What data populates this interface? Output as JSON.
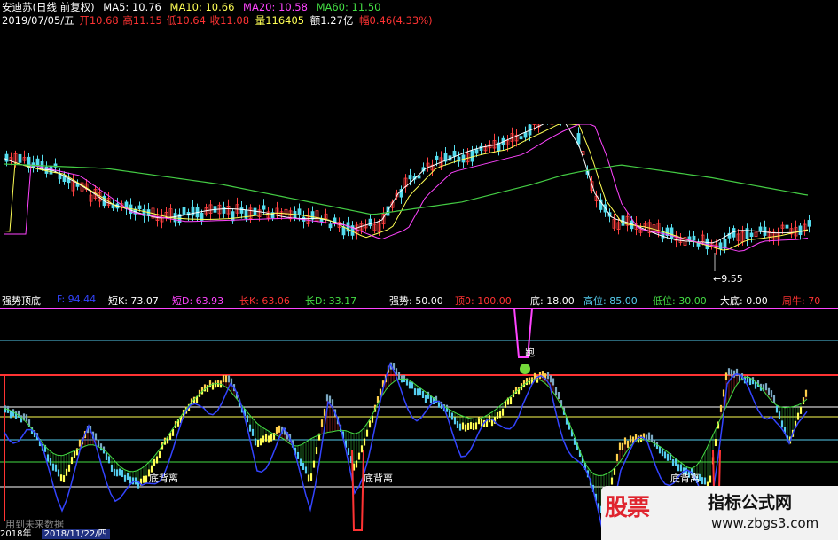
{
  "header": {
    "title": "安迪苏(日线 前复权)",
    "ma5": "MA5: 10.76",
    "ma10": "MA10: 10.66",
    "ma20": "MA20: 10.58",
    "ma60": "MA60: 11.50",
    "date": "2019/07/05/五",
    "open": "开10.68",
    "high": "高11.15",
    "low": "低10.64",
    "close": "收11.08",
    "volume": "量116405",
    "amount": "额1.27亿",
    "change": "幅0.46(4.33%)"
  },
  "price_annotation": "←9.55",
  "indicator": {
    "name": "强势顶底",
    "f": "F: 94.44",
    "short_k": "短K: 73.07",
    "short_d": "短D: 63.93",
    "long_k": "长K: 63.06",
    "long_d": "长D: 33.17",
    "strong": "强势: 50.00",
    "top": "顶0: 100.00",
    "bottom": "底: 18.00",
    "high_level": "高位: 85.00",
    "low_level": "低位: 30.00",
    "big_bottom": "大底: 0.00",
    "bull": "周牛: 70"
  },
  "chart_labels": {
    "divergence_1": "底背离",
    "divergence_2": "底背离",
    "divergence_3": "底背离",
    "run": "跑"
  },
  "bottom_bar": {
    "left": "2018年",
    "future": "用到未来数据",
    "date": "2018/11/22/四"
  },
  "watermark": {
    "red": "股票",
    "title": "指标公式网",
    "url": "www.zbgs3.com"
  },
  "colors": {
    "white": "#ffffff",
    "yellow": "#ffff55",
    "magenta": "#ff44ff",
    "green": "#44dd44",
    "cyan": "#55ccee",
    "red": "#ff3333",
    "blue": "#3344ff"
  }
}
